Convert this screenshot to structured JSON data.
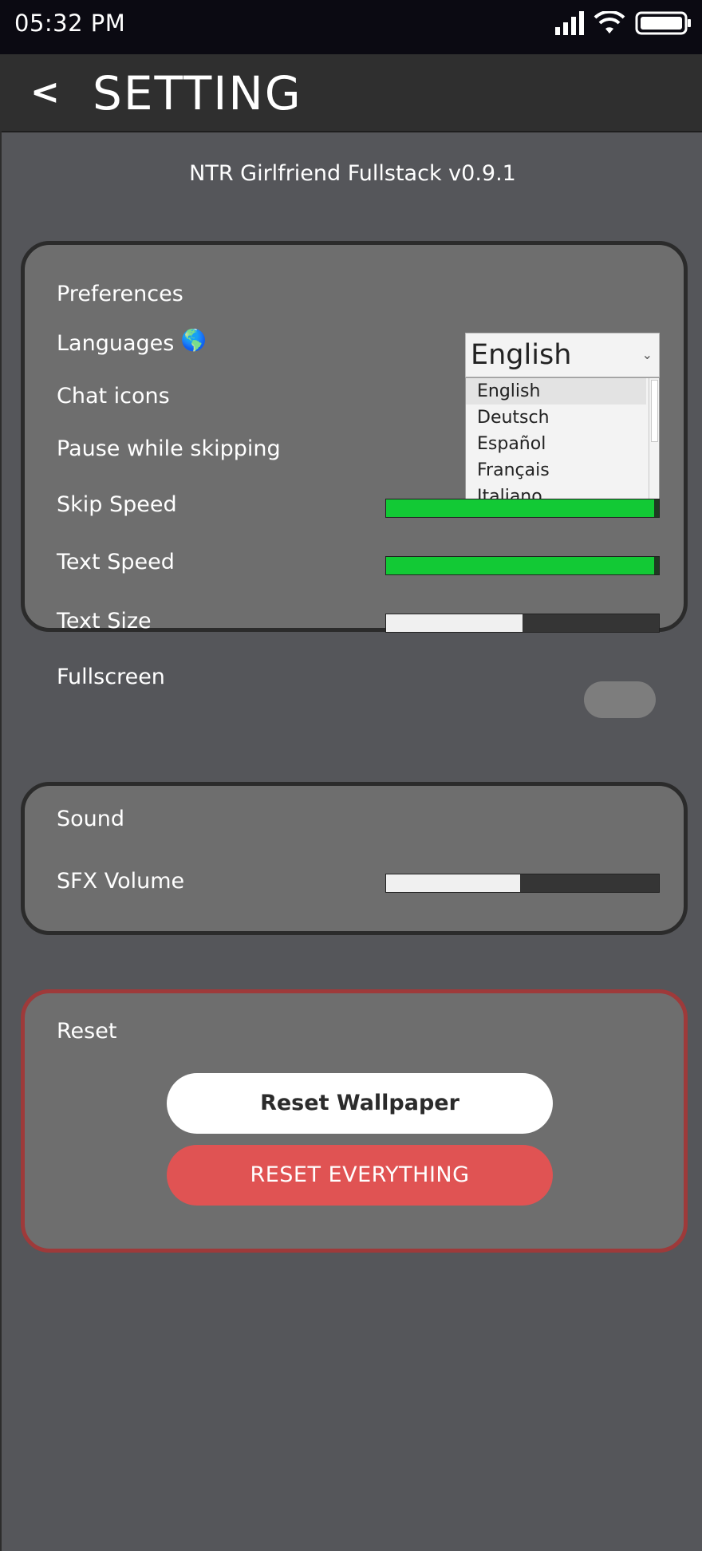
{
  "status_bar": {
    "time": "05:32 PM"
  },
  "header": {
    "back_label": "<",
    "title": "SETTING"
  },
  "version": "NTR Girlfriend Fullstack v0.9.1",
  "preferences": {
    "title": "Preferences",
    "languages_label": "Languages",
    "languages_icon": "🌎",
    "language_selected": "English",
    "language_options": [
      "English",
      "Deutsch",
      "Español",
      "Français",
      "Italiano"
    ],
    "chat_icons_label": "Chat icons",
    "pause_label": "Pause while skipping",
    "skip_speed_label": "Skip Speed",
    "skip_speed_value": 1.0,
    "text_speed_label": "Text Speed",
    "text_speed_value": 1.0,
    "text_size_label": "Text Size",
    "text_size_value": 0.5,
    "fullscreen_label": "Fullscreen",
    "fullscreen_on": false
  },
  "sound": {
    "title": "Sound",
    "sfx_label": "SFX Volume",
    "sfx_value": 0.49
  },
  "reset": {
    "title": "Reset",
    "wallpaper_label": "Reset Wallpaper",
    "everything_label": "RESET EVERYTHING"
  },
  "colors": {
    "accent_green": "#12c935",
    "danger_red": "#e05353",
    "card_bg": "#6e6e6e",
    "page_bg": "#55565a"
  }
}
